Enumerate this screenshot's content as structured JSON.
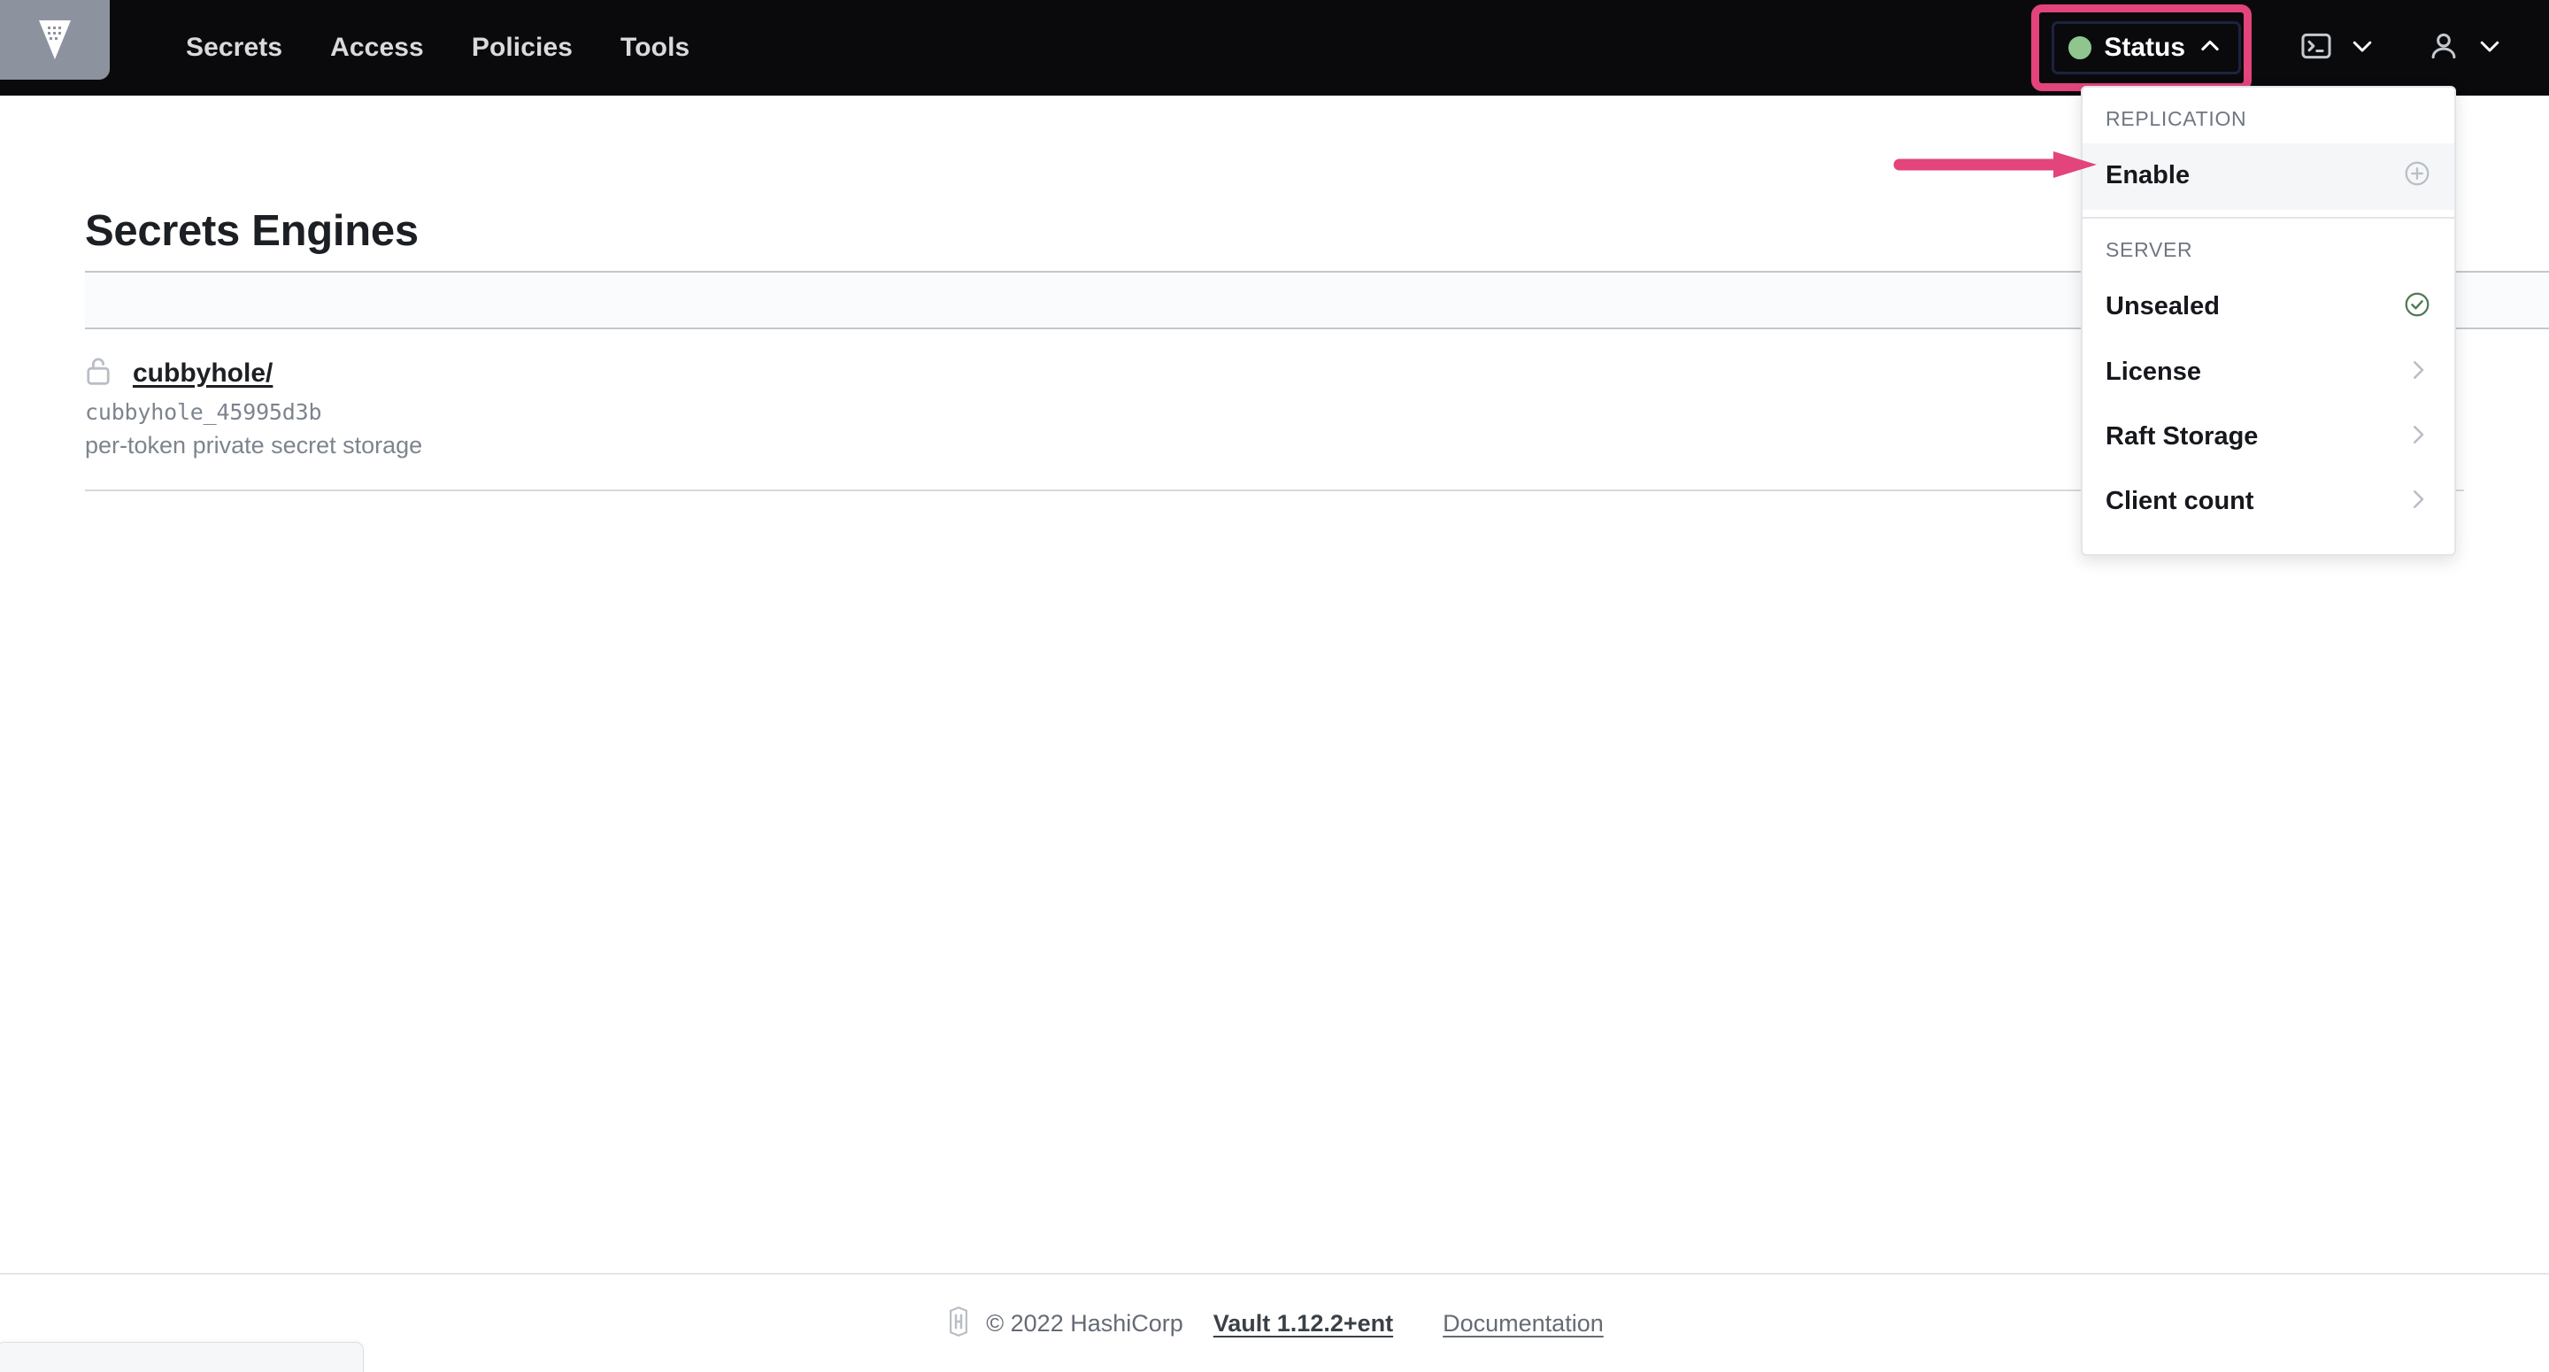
{
  "navbar": {
    "logo_icon": "vault-logo-icon",
    "links": [
      {
        "label": "Secrets"
      },
      {
        "label": "Access"
      },
      {
        "label": "Policies"
      },
      {
        "label": "Tools"
      }
    ],
    "status_button": {
      "label": "Status",
      "indicator_color": "#8ec68e",
      "chevron_icon": "chevron-up-icon",
      "highlight_color": "#e2447b"
    },
    "console_icon": "terminal-icon",
    "console_chevron_icon": "chevron-down-icon",
    "user_icon": "user-icon",
    "user_chevron_icon": "chevron-down-icon"
  },
  "main": {
    "page_title": "Secrets Engines",
    "engines": [
      {
        "lock_icon": "unlock-icon",
        "path": "cubbyhole/",
        "accessor": "cubbyhole_45995d3b",
        "description": "per-token private secret storage"
      }
    ]
  },
  "status_dropdown": {
    "sections": [
      {
        "label": "REPLICATION",
        "items": [
          {
            "label": "Enable",
            "icon": "plus-circle-icon",
            "active": true
          }
        ]
      },
      {
        "label": "SERVER",
        "items": [
          {
            "label": "Unsealed",
            "icon": "check-circle-icon",
            "icon_color": "#4f7a52"
          },
          {
            "label": "License",
            "icon": "chevron-right-icon"
          },
          {
            "label": "Raft Storage",
            "icon": "chevron-right-icon"
          },
          {
            "label": "Client count",
            "icon": "chevron-right-icon"
          }
        ]
      }
    ]
  },
  "footer": {
    "logo_icon": "hashicorp-icon",
    "copyright": "© 2022 HashiCorp",
    "version_link": "Vault 1.12.2+ent",
    "documentation_link": "Documentation"
  }
}
